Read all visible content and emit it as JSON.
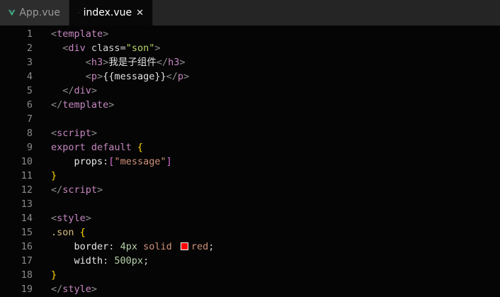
{
  "tabs": [
    {
      "label": "App.vue",
      "active": false
    },
    {
      "label": "index.vue",
      "active": true,
      "close_icon": "close-icon"
    }
  ],
  "colors": {
    "vue_green": "#41b883",
    "swatch_red": "#ff0000"
  },
  "editor": {
    "lines": [
      {
        "n": "1",
        "tokens": [
          {
            "c": "t-bracket",
            "t": "<"
          },
          {
            "c": "t-tag",
            "t": "template"
          },
          {
            "c": "t-bracket",
            "t": ">"
          }
        ]
      },
      {
        "n": "2",
        "tokens": [
          {
            "c": "code",
            "t": "  "
          },
          {
            "c": "t-bracket",
            "t": "<"
          },
          {
            "c": "t-tag",
            "t": "div"
          },
          {
            "c": "t-attr",
            "t": " class="
          },
          {
            "c": "t-str",
            "t": "\"son\""
          },
          {
            "c": "t-bracket",
            "t": ">"
          }
        ]
      },
      {
        "n": "3",
        "tokens": [
          {
            "c": "code",
            "t": "      "
          },
          {
            "c": "t-bracket",
            "t": "<"
          },
          {
            "c": "t-tag",
            "t": "h3"
          },
          {
            "c": "t-bracket",
            "t": ">"
          },
          {
            "c": "t-text",
            "t": "我是子组件"
          },
          {
            "c": "t-bracket",
            "t": "</"
          },
          {
            "c": "t-tag",
            "t": "h3"
          },
          {
            "c": "t-bracket",
            "t": ">"
          }
        ]
      },
      {
        "n": "4",
        "tokens": [
          {
            "c": "code",
            "t": "      "
          },
          {
            "c": "t-bracket",
            "t": "<"
          },
          {
            "c": "t-tag",
            "t": "p"
          },
          {
            "c": "t-bracket",
            "t": ">"
          },
          {
            "c": "t-text",
            "t": "{{message}}"
          },
          {
            "c": "t-bracket",
            "t": "</"
          },
          {
            "c": "t-tag",
            "t": "p"
          },
          {
            "c": "t-bracket",
            "t": ">"
          }
        ]
      },
      {
        "n": "5",
        "tokens": [
          {
            "c": "code",
            "t": "  "
          },
          {
            "c": "t-bracket",
            "t": "</"
          },
          {
            "c": "t-tag",
            "t": "div"
          },
          {
            "c": "t-bracket",
            "t": ">"
          }
        ]
      },
      {
        "n": "6",
        "tokens": [
          {
            "c": "t-bracket",
            "t": "</"
          },
          {
            "c": "t-tag",
            "t": "template"
          },
          {
            "c": "t-bracket",
            "t": ">"
          }
        ]
      },
      {
        "n": "7",
        "tokens": []
      },
      {
        "n": "8",
        "tokens": [
          {
            "c": "t-bracket",
            "t": "<"
          },
          {
            "c": "t-tag",
            "t": "script"
          },
          {
            "c": "t-bracket",
            "t": ">"
          }
        ]
      },
      {
        "n": "9",
        "tokens": [
          {
            "c": "t-kw",
            "t": "export default "
          },
          {
            "c": "t-brace",
            "t": "{"
          }
        ]
      },
      {
        "n": "10",
        "tokens": [
          {
            "c": "code",
            "t": "    "
          },
          {
            "c": "t-prop",
            "t": "props"
          },
          {
            "c": "code",
            "t": ":"
          },
          {
            "c": "t-mbrace",
            "t": "["
          },
          {
            "c": "t-val",
            "t": "\"message\""
          },
          {
            "c": "t-mbrace",
            "t": "]"
          }
        ]
      },
      {
        "n": "11",
        "tokens": [
          {
            "c": "t-brace",
            "t": "}"
          }
        ]
      },
      {
        "n": "12",
        "tokens": [
          {
            "c": "t-bracket",
            "t": "</"
          },
          {
            "c": "t-tag",
            "t": "script"
          },
          {
            "c": "t-bracket",
            "t": ">"
          }
        ]
      },
      {
        "n": "13",
        "tokens": []
      },
      {
        "n": "14",
        "tokens": [
          {
            "c": "t-bracket",
            "t": "<"
          },
          {
            "c": "t-tag",
            "t": "style"
          },
          {
            "c": "t-bracket",
            "t": ">"
          }
        ]
      },
      {
        "n": "15",
        "tokens": [
          {
            "c": "t-sel",
            "t": ".son "
          },
          {
            "c": "t-brace",
            "t": "{"
          }
        ]
      },
      {
        "n": "16",
        "tokens": [
          {
            "c": "code",
            "t": "    "
          },
          {
            "c": "t-prop",
            "t": "border"
          },
          {
            "c": "code",
            "t": ": "
          },
          {
            "c": "t-num",
            "t": "4px"
          },
          {
            "c": "t-val",
            "t": " solid "
          },
          {
            "c": "swatch",
            "t": ""
          },
          {
            "c": "t-val",
            "t": "red"
          },
          {
            "c": "code",
            "t": ";"
          }
        ]
      },
      {
        "n": "17",
        "tokens": [
          {
            "c": "code",
            "t": "    "
          },
          {
            "c": "t-prop",
            "t": "width"
          },
          {
            "c": "code",
            "t": ": "
          },
          {
            "c": "t-num",
            "t": "500px"
          },
          {
            "c": "code",
            "t": ";"
          }
        ]
      },
      {
        "n": "18",
        "tokens": [
          {
            "c": "t-brace",
            "t": "}"
          }
        ]
      },
      {
        "n": "19",
        "tokens": [
          {
            "c": "t-bracket",
            "t": "</"
          },
          {
            "c": "t-tag",
            "t": "style"
          },
          {
            "c": "t-bracket",
            "t": ">"
          }
        ]
      }
    ]
  }
}
